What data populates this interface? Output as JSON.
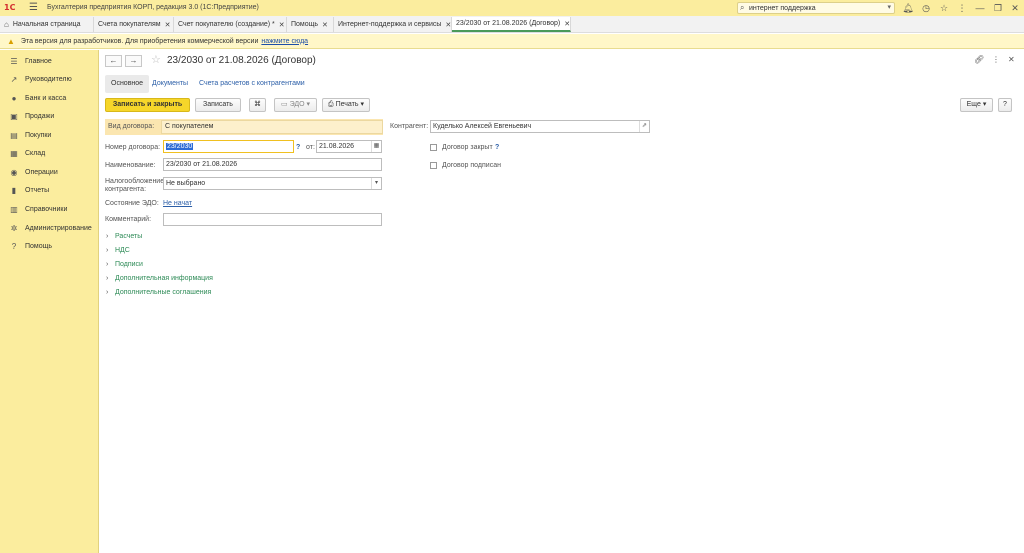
{
  "app": {
    "logo_text": "1С",
    "title": "Бухгалтерия предприятия КОРП, редакция 3.0  (1С:Предприятие)"
  },
  "search": {
    "value": "интернет поддержка"
  },
  "icons": {
    "bell": "bell-icon",
    "history": "history-icon",
    "star": "star-icon",
    "menu": "menu-icon",
    "minimize": "minimize-icon",
    "restore": "restore-icon",
    "close": "close-icon"
  },
  "tabs": [
    {
      "label": "Начальная страница",
      "closable": false
    },
    {
      "label": "Счета покупателям",
      "closable": true
    },
    {
      "label": "Счет покупателю (создание) *",
      "closable": true
    },
    {
      "label": "Помощь",
      "closable": true
    },
    {
      "label": "Интернет-поддержка и сервисы",
      "closable": true
    },
    {
      "label": "23/2030 от 21.08.2026 (Договор)",
      "closable": true
    }
  ],
  "warning": {
    "text": "Эта версия для разработчиков. Для приобретения коммерческой версии",
    "link": "нажмите сюда"
  },
  "sidebar": {
    "items": [
      {
        "label": "Главное",
        "icon": "menu-icon"
      },
      {
        "label": "Руководителю",
        "icon": "chart-trend-icon"
      },
      {
        "label": "Банк и касса",
        "icon": "coins-icon"
      },
      {
        "label": "Продажи",
        "icon": "sales-icon"
      },
      {
        "label": "Покупки",
        "icon": "cart-icon"
      },
      {
        "label": "Склад",
        "icon": "warehouse-icon"
      },
      {
        "label": "Операции",
        "icon": "operations-icon"
      },
      {
        "label": "Отчеты",
        "icon": "bar-chart-icon"
      },
      {
        "label": "Справочники",
        "icon": "book-icon"
      },
      {
        "label": "Администрирование",
        "icon": "gear-icon"
      },
      {
        "label": "Помощь",
        "icon": "help-icon"
      }
    ]
  },
  "form": {
    "title": "23/2030 от 21.08.2026 (Договор)",
    "subtabs": [
      "Основное",
      "Документы",
      "Счета расчетов с контрагентами"
    ],
    "toolbar": {
      "save_close": "Записать и закрыть",
      "save": "Записать",
      "edo": "ЭДО",
      "print": "Печать",
      "more": "Еще",
      "help": "?"
    },
    "kind_label": "Вид договора:",
    "kind_value": "С покупателем",
    "counterparty_label": "Контрагент:",
    "counterparty_value": "Куделько Алексей Евгеньевич",
    "number_label": "Номер договора:",
    "number_value": "23/2030",
    "date_label": "от:",
    "date_value": "21.08.2026",
    "name_label": "Наименование:",
    "name_value": "23/2030 от 21.08.2026",
    "tax_label_1": "Налогообложение",
    "tax_label_2": "контрагента:",
    "tax_value": "Не выбрано",
    "edo_state_label": "Состояние ЭДО:",
    "edo_state_value": "Не начат",
    "comment_label": "Комментарий:",
    "comment_value": "",
    "closed_label": "Договор закрыт",
    "closed_checked": false,
    "signed_label": "Договор подписан",
    "signed_checked": false,
    "groups": [
      "Расчеты",
      "НДС",
      "Подписи",
      "Дополнительная информация",
      "Дополнительные соглашения"
    ]
  },
  "colors": {
    "sidebar_bg": "#fbed9e",
    "primary_button": "#f6d62a",
    "link": "#2c5fa8",
    "group_link": "#2e8b57"
  }
}
